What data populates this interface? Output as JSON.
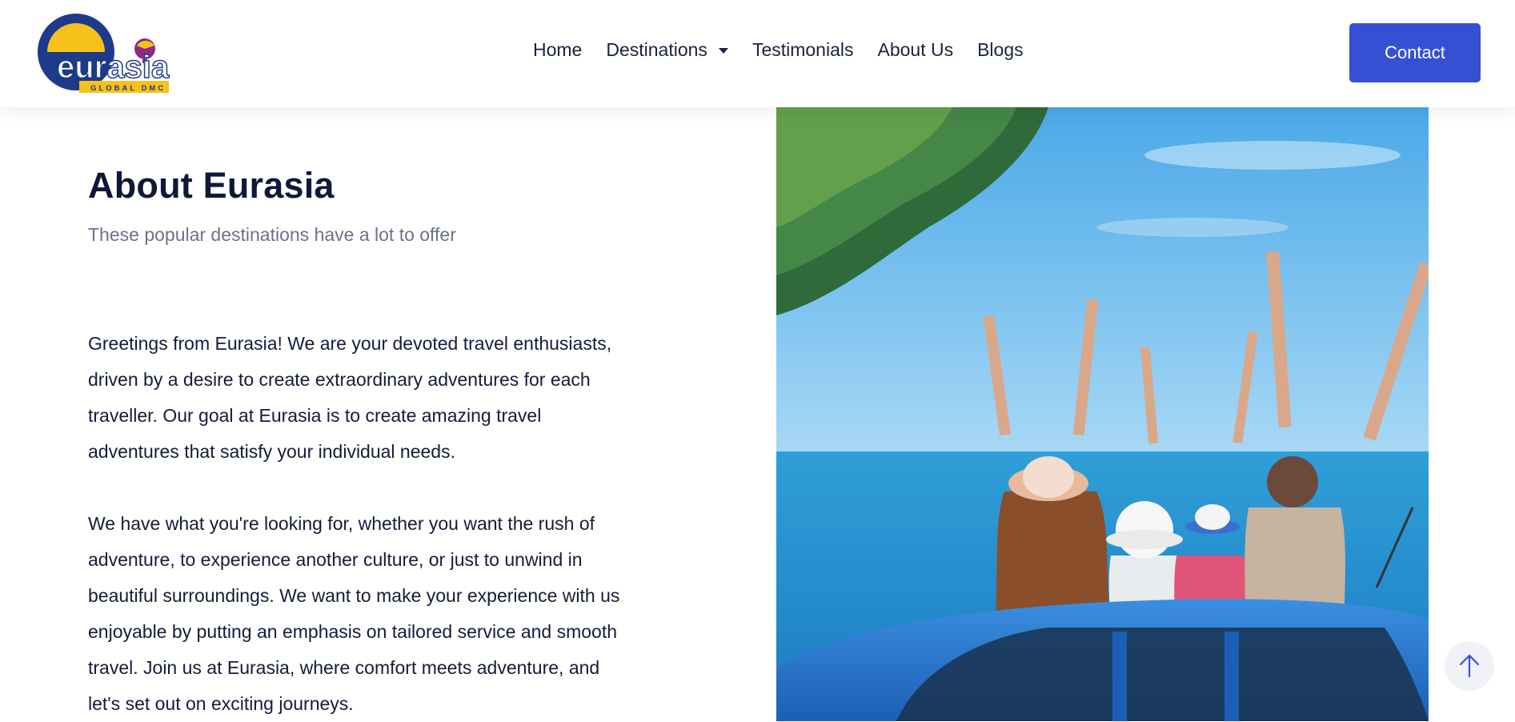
{
  "header": {
    "logo": {
      "wordmark": "eurasia",
      "tagline": "GLOBAL DMC"
    },
    "nav": [
      {
        "label": "Home"
      },
      {
        "label": "Destinations",
        "has_dropdown": true
      },
      {
        "label": "Testimonials"
      },
      {
        "label": "About Us"
      },
      {
        "label": "Blogs"
      }
    ],
    "contact_label": "Contact"
  },
  "about": {
    "title": "About Eurasia",
    "subtitle": "These popular destinations have a lot to offer",
    "paragraph_1": "Greetings from Eurasia! We are your devoted travel enthusiasts, driven by a desire to create extraordinary adventures for each traveller. Our goal at Eurasia is to create amazing travel adventures that satisfy your individual needs.",
    "paragraph_2": "We have what you're looking for, whether you want the rush of adventure, to experience another culture, or just to unwind in beautiful surroundings. We want to make your experience with us enjoyable by putting an emphasis on tailored service and smooth travel. Join us at Eurasia, where comfort meets adventure, and let's set out on exciting journeys."
  },
  "hero_image": {
    "description_icon": "family-on-car-photo"
  },
  "scroll_top": {
    "icon": "arrow-up-icon"
  },
  "colors": {
    "brand_blue": "#3650d4",
    "logo_navy": "#1e3a8a",
    "logo_yellow": "#f6c21a",
    "heading": "#0f1838",
    "muted": "#6c7386"
  }
}
